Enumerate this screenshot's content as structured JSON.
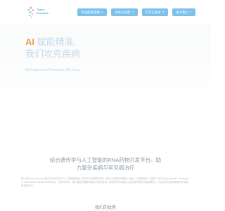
{
  "header": {
    "logo_text_line1": "Thera",
    "logo_text_line2": "Innovera",
    "nav": [
      {
        "label": "专注疾病领域",
        "has_dropdown": true
      },
      {
        "label": "平台与创新",
        "has_dropdown": true
      },
      {
        "label": "科学与技术",
        "has_dropdown": true
      },
      {
        "label": "关于我们",
        "has_dropdown": true
      }
    ]
  },
  "hero": {
    "ai": "AI",
    "line1_rest": " 赋能精准,",
    "line2": "我们攻克疾病",
    "subtitle": "AI Empowered Precision, We Cure"
  },
  "intro": {
    "title_line1": "结合遗传学与人工智能的RNA药物开发平台，助",
    "title_line2": "力复杂疾病与罕见病治疗",
    "body": "赛以诺(Thera Innovera)的平台将遗传学与人工智能相结合，助力RNA药物的开发。我们以遗传学为基础，结合人工智能技术，构建'SAGE平台'(combined Genomics, AI and modified siRNA Efficiency)，以靶向RNA。我们通过挖掘疾病相关的遗传变异，精准识别与疾病发生发展密切相关的基因靶点，开发出针对复杂疾病与罕见病的创新疗法。"
  },
  "section": {
    "title": "我们的优势"
  },
  "colors": {
    "accent": "#e8a23a",
    "nav_bg": "#7cc1ea",
    "hero_text": "#c7dbe8"
  }
}
